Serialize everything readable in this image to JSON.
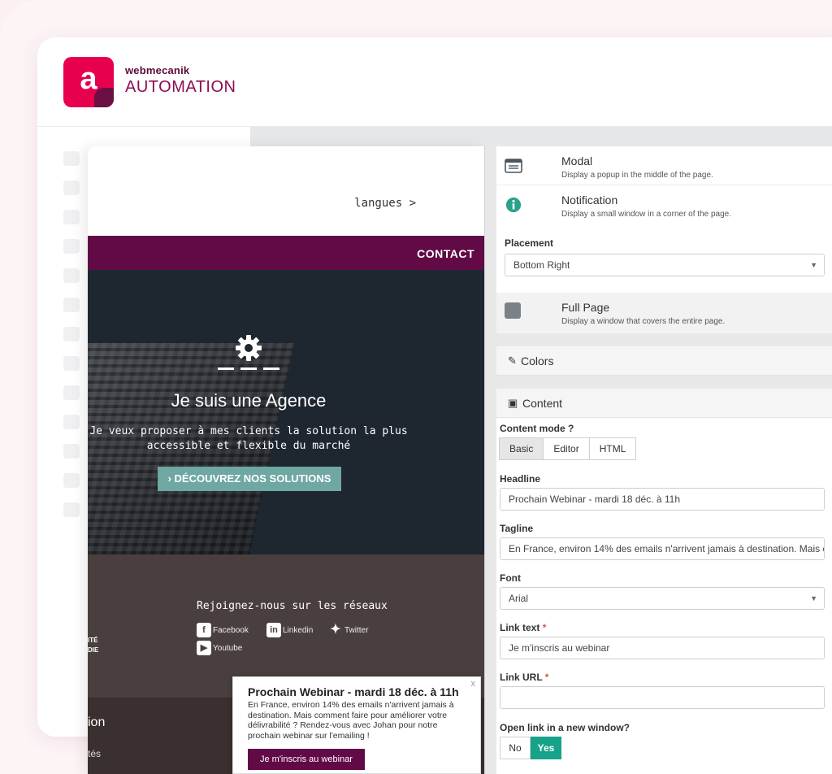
{
  "brand": {
    "small": "webmecanik",
    "big": "AUTOMATION",
    "logo_letter": "a"
  },
  "site": {
    "langues": "langues >",
    "contact": "CONTACT",
    "hero_title": "Je suis une Agence",
    "hero_sub_line1": "Je veux proposer à mes clients la solution la plus",
    "hero_sub_line2": "accessible et flexible du marché",
    "hero_button": "› DÉCOUVREZ NOS SOLUTIONS",
    "social_title": "Rejoignez-nous sur les réseaux",
    "social": {
      "facebook": "Facebook",
      "linkedin": "Linkedin",
      "twitter": "Twitter",
      "youtube": "Youtube"
    },
    "partial_left_1": "ITÉ",
    "partial_left_2": "DIE",
    "bottom_1": "ion",
    "bottom_2": "tés"
  },
  "popup": {
    "close": "x",
    "title": "Prochain Webinar - mardi 18 déc. à 11h",
    "body": "En France, environ 14% des emails n'arrivent jamais à destination. Mais comment faire pour améliorer votre délivrabilité ? Rendez-vous avec Johan pour notre prochain webinar sur l'emailing !",
    "button": "Je m'inscris au webinar"
  },
  "panel": {
    "modal": {
      "title": "Modal",
      "desc": "Display a popup in the middle of the page."
    },
    "notification": {
      "title": "Notification",
      "desc": "Display a small window in a corner of the page."
    },
    "placement_label": "Placement",
    "placement_value": "Bottom Right",
    "fullpage": {
      "title": "Full Page",
      "desc": "Display a window that covers the entire page."
    },
    "colors_label": "Colors",
    "content_label": "Content",
    "content_mode_label": "Content mode",
    "content_modes": [
      "Basic",
      "Editor",
      "HTML"
    ],
    "headline_label": "Headline",
    "headline_value": "Prochain Webinar - mardi 18 déc. à 11h",
    "tagline_label": "Tagline",
    "tagline_value": "En France, environ 14% des emails n'arrivent jamais à destination. Mais c",
    "font_label": "Font",
    "font_value": "Arial",
    "link_text_label": "Link text",
    "link_text_value": "Je m'inscris au webinar",
    "link_url_label": "Link URL",
    "link_url_value": "",
    "new_window_label": "Open link in a new window?",
    "no": "No",
    "yes": "Yes",
    "required_mark": "*"
  },
  "colors": {
    "brand": "#e6004e",
    "brand_dark": "#620a46",
    "accent": "#17a28a",
    "hero_button": "#6fa7a3"
  }
}
